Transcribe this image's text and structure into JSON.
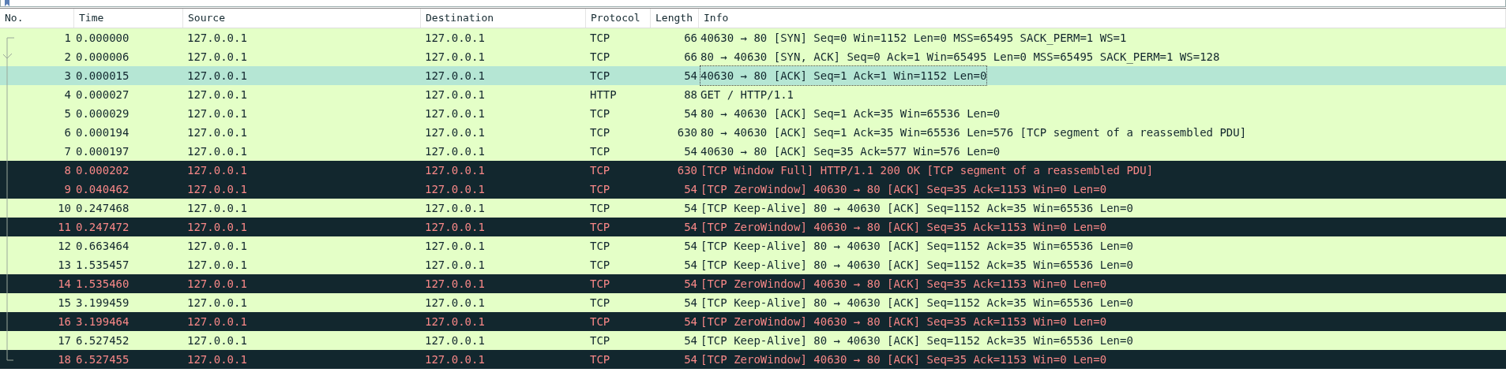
{
  "packet_list": {
    "columns": [
      "No.",
      "Time",
      "Source",
      "Destination",
      "Protocol",
      "Length",
      "Info"
    ],
    "rows": [
      {
        "cells": [
          "1",
          "0.000000",
          "127.0.0.1",
          "127.0.0.1",
          "TCP",
          "66",
          "40630 → 80 [SYN] Seq=0 Win=1152 Len=0 MSS=65495 SACK_PERM=1 WS=1"
        ],
        "kind": "normal",
        "selected": false
      },
      {
        "cells": [
          "2",
          "0.000006",
          "127.0.0.1",
          "127.0.0.1",
          "TCP",
          "66",
          "80 → 40630 [SYN, ACK] Seq=0 Ack=1 Win=65495 Len=0 MSS=65495 SACK_PERM=1 WS=128"
        ],
        "kind": "normal",
        "selected": false
      },
      {
        "cells": [
          "3",
          "0.000015",
          "127.0.0.1",
          "127.0.0.1",
          "TCP",
          "54",
          "40630 → 80 [ACK] Seq=1 Ack=1 Win=1152 Len=0"
        ],
        "kind": "normal",
        "selected": true
      },
      {
        "cells": [
          "4",
          "0.000027",
          "127.0.0.1",
          "127.0.0.1",
          "HTTP",
          "88",
          "GET / HTTP/1.1"
        ],
        "kind": "normal",
        "selected": false
      },
      {
        "cells": [
          "5",
          "0.000029",
          "127.0.0.1",
          "127.0.0.1",
          "TCP",
          "54",
          "80 → 40630 [ACK] Seq=1 Ack=35 Win=65536 Len=0"
        ],
        "kind": "normal",
        "selected": false
      },
      {
        "cells": [
          "6",
          "0.000194",
          "127.0.0.1",
          "127.0.0.1",
          "TCP",
          "630",
          "80 → 40630 [ACK] Seq=1 Ack=35 Win=65536 Len=576 [TCP segment of a reassembled PDU]"
        ],
        "kind": "normal",
        "selected": false
      },
      {
        "cells": [
          "7",
          "0.000197",
          "127.0.0.1",
          "127.0.0.1",
          "TCP",
          "54",
          "40630 → 80 [ACK] Seq=35 Ack=577 Win=576 Len=0"
        ],
        "kind": "normal",
        "selected": false
      },
      {
        "cells": [
          "8",
          "0.000202",
          "127.0.0.1",
          "127.0.0.1",
          "TCP",
          "630",
          "[TCP Window Full] HTTP/1.1 200 OK  [TCP segment of a reassembled PDU]"
        ],
        "kind": "bad",
        "selected": false
      },
      {
        "cells": [
          "9",
          "0.040462",
          "127.0.0.1",
          "127.0.0.1",
          "TCP",
          "54",
          "[TCP ZeroWindow] 40630 → 80 [ACK] Seq=35 Ack=1153 Win=0 Len=0"
        ],
        "kind": "bad",
        "selected": false
      },
      {
        "cells": [
          "10",
          "0.247468",
          "127.0.0.1",
          "127.0.0.1",
          "TCP",
          "54",
          "[TCP Keep-Alive] 80 → 40630 [ACK] Seq=1152 Ack=35 Win=65536 Len=0"
        ],
        "kind": "normal",
        "selected": false
      },
      {
        "cells": [
          "11",
          "0.247472",
          "127.0.0.1",
          "127.0.0.1",
          "TCP",
          "54",
          "[TCP ZeroWindow] 40630 → 80 [ACK] Seq=35 Ack=1153 Win=0 Len=0"
        ],
        "kind": "bad",
        "selected": false
      },
      {
        "cells": [
          "12",
          "0.663464",
          "127.0.0.1",
          "127.0.0.1",
          "TCP",
          "54",
          "[TCP Keep-Alive] 80 → 40630 [ACK] Seq=1152 Ack=35 Win=65536 Len=0"
        ],
        "kind": "normal",
        "selected": false
      },
      {
        "cells": [
          "13",
          "1.535457",
          "127.0.0.1",
          "127.0.0.1",
          "TCP",
          "54",
          "[TCP Keep-Alive] 80 → 40630 [ACK] Seq=1152 Ack=35 Win=65536 Len=0"
        ],
        "kind": "normal",
        "selected": false
      },
      {
        "cells": [
          "14",
          "1.535460",
          "127.0.0.1",
          "127.0.0.1",
          "TCP",
          "54",
          "[TCP ZeroWindow] 40630 → 80 [ACK] Seq=35 Ack=1153 Win=0 Len=0"
        ],
        "kind": "bad",
        "selected": false
      },
      {
        "cells": [
          "15",
          "3.199459",
          "127.0.0.1",
          "127.0.0.1",
          "TCP",
          "54",
          "[TCP Keep-Alive] 80 → 40630 [ACK] Seq=1152 Ack=35 Win=65536 Len=0"
        ],
        "kind": "normal",
        "selected": false
      },
      {
        "cells": [
          "16",
          "3.199464",
          "127.0.0.1",
          "127.0.0.1",
          "TCP",
          "54",
          "[TCP ZeroWindow] 40630 → 80 [ACK] Seq=35 Ack=1153 Win=0 Len=0"
        ],
        "kind": "bad",
        "selected": false
      },
      {
        "cells": [
          "17",
          "6.527452",
          "127.0.0.1",
          "127.0.0.1",
          "TCP",
          "54",
          "[TCP Keep-Alive] 80 → 40630 [ACK] Seq=1152 Ack=35 Win=65536 Len=0"
        ],
        "kind": "normal",
        "selected": false
      },
      {
        "cells": [
          "18",
          "6.527455",
          "127.0.0.1",
          "127.0.0.1",
          "TCP",
          "54",
          "[TCP ZeroWindow] 40630 → 80 [ACK] Seq=35 Ack=1153 Win=0 Len=0"
        ],
        "kind": "bad",
        "selected": false
      }
    ]
  }
}
